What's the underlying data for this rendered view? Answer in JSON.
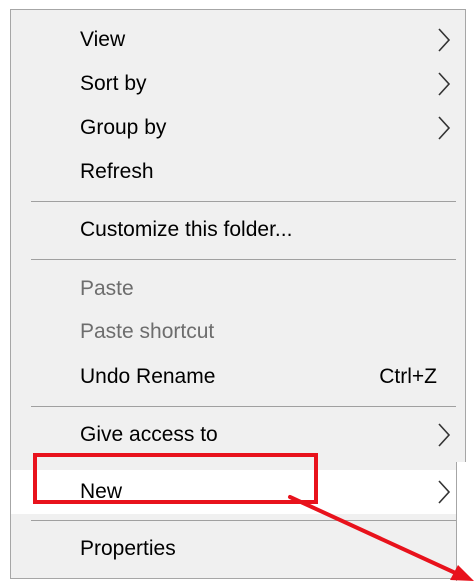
{
  "menu": {
    "items": [
      {
        "label": "View",
        "has_submenu": true
      },
      {
        "label": "Sort by",
        "has_submenu": true
      },
      {
        "label": "Group by",
        "has_submenu": true
      },
      {
        "label": "Refresh"
      },
      {
        "label": "Customize this folder..."
      },
      {
        "label": "Paste",
        "disabled": true
      },
      {
        "label": "Paste shortcut",
        "disabled": true
      },
      {
        "label": "Undo Rename",
        "shortcut": "Ctrl+Z"
      },
      {
        "label": "Give access to",
        "has_submenu": true
      },
      {
        "label": "New",
        "has_submenu": true,
        "highlighted": true
      },
      {
        "label": "Properties"
      }
    ],
    "icons": {
      "submenu": "chevron-right-icon"
    }
  },
  "annotation": {
    "highlight_color": "#e8121c",
    "highlighted_item": "New"
  },
  "colors": {
    "menu_background": "#f0f0f0",
    "disabled_text": "#6d6d6d",
    "highlight_row": "#ffffff"
  }
}
